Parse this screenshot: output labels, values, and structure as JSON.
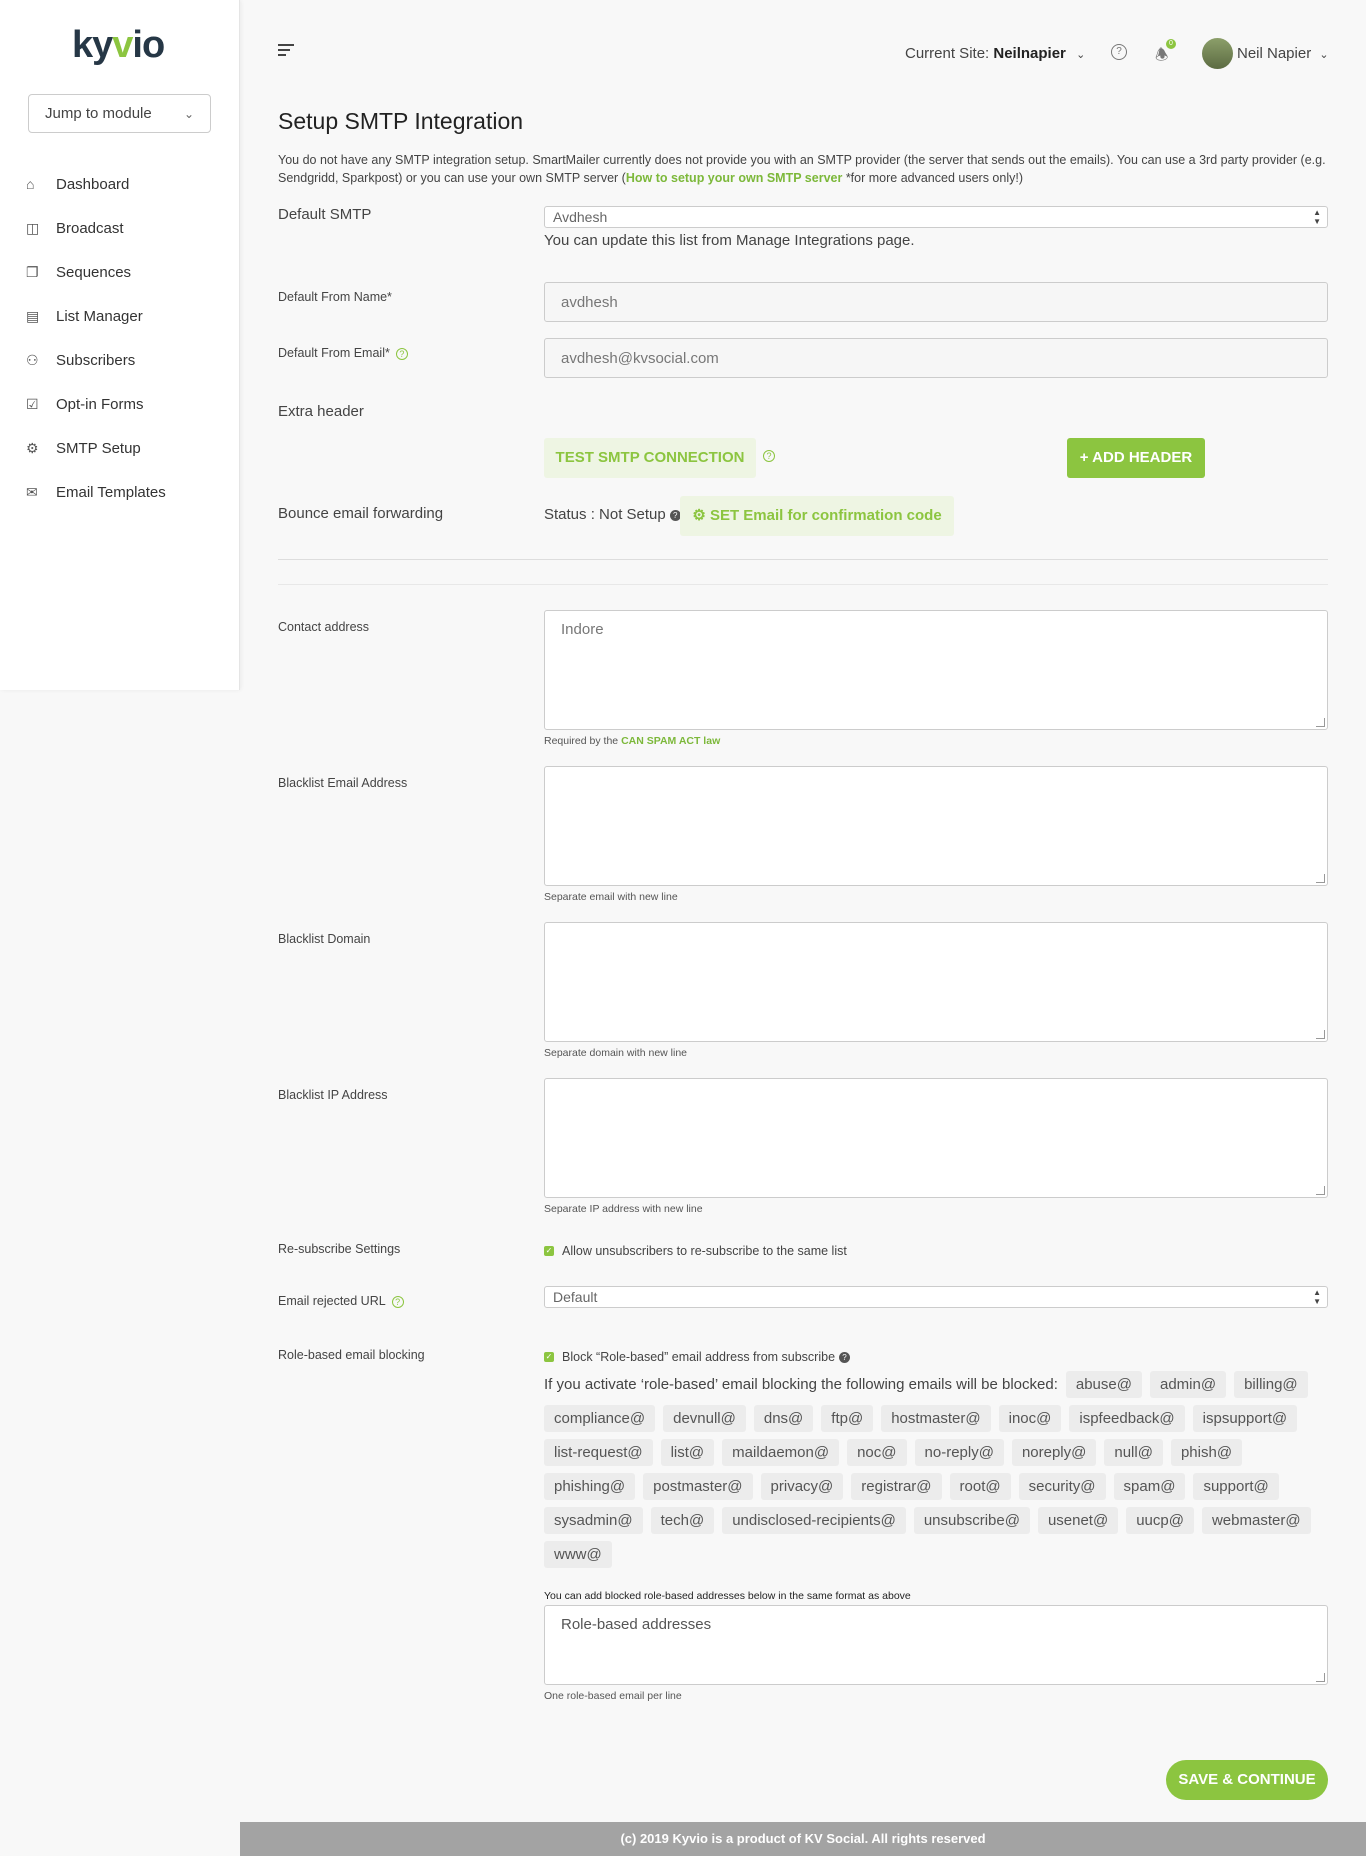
{
  "brand": {
    "logo_text_1": "ky",
    "logo_text_2": "v",
    "logo_text_3": "io"
  },
  "sidebar": {
    "jump_label": "Jump to module",
    "items": [
      {
        "label": "Dashboard",
        "icon": "home-icon"
      },
      {
        "label": "Broadcast",
        "icon": "broadcast-icon"
      },
      {
        "label": "Sequences",
        "icon": "sequences-icon"
      },
      {
        "label": "List Manager",
        "icon": "list-icon"
      },
      {
        "label": "Subscribers",
        "icon": "users-icon"
      },
      {
        "label": "Opt-in Forms",
        "icon": "checkbox-icon"
      },
      {
        "label": "SMTP Setup",
        "icon": "gear-icon"
      },
      {
        "label": "Email Templates",
        "icon": "envelope-icon"
      }
    ]
  },
  "header": {
    "site_prefix": "Current Site:",
    "site_name": "Neilnapier",
    "notif_count": "0",
    "user_name": "Neil Napier"
  },
  "main": {
    "title": "Setup SMTP Integration",
    "intro_1": "You do not have any SMTP integration setup. SmartMailer currently does not provide you with an SMTP provider (the server that sends out the emails). You can use a 3rd party provider (e.g. Sendgridd, Sparkpost) or you can use your own SMTP server (",
    "intro_link": "How to setup your own SMTP server",
    "intro_2": " *for more advanced users only!)",
    "default_smtp_label": "Default SMTP",
    "default_smtp_value": "Avdhesh",
    "default_smtp_note": "You can update this list from Manage Integrations page.",
    "from_name_label": "Default From Name*",
    "from_name_value": "avdhesh",
    "from_email_label": "Default From Email*",
    "from_email_value": "avdhesh@kvsocial.com",
    "extra_header_label": "Extra header",
    "test_btn": "TEST SMTP CONNECTION",
    "add_header_btn": "+ ADD HEADER",
    "bounce_label": "Bounce email forwarding",
    "bounce_status": "Status : Not Setup",
    "bounce_btn": "SET Email for confirmation code",
    "contact_label": "Contact address",
    "contact_value": "Indore",
    "contact_help_1": "Required by the ",
    "contact_help_link": "CAN SPAM ACT law",
    "bl_email_label": "Blacklist Email Address",
    "bl_email_help": "Separate email with new line",
    "bl_domain_label": "Blacklist Domain",
    "bl_domain_help": "Separate domain with new line",
    "bl_ip_label": "Blacklist IP Address",
    "bl_ip_help": "Separate IP address with new line",
    "resub_label": "Re-subscribe Settings",
    "resub_check": "Allow unsubscribers to re-subscribe to the same list",
    "rejected_label": "Email rejected URL",
    "rejected_value": "Default",
    "role_label": "Role-based email blocking",
    "role_check": "Block “Role-based” email address from subscribe",
    "role_intro": "If you activate ‘role-based’ email blocking the following emails will be blocked:",
    "role_tags": [
      "abuse@",
      "admin@",
      "billing@",
      "compliance@",
      "devnull@",
      "dns@",
      "ftp@",
      "hostmaster@",
      "inoc@",
      "ispfeedback@",
      "ispsupport@",
      "list-request@",
      "list@",
      "maildaemon@",
      "noc@",
      "no-reply@",
      "noreply@",
      "null@",
      "phish@",
      "phishing@",
      "postmaster@",
      "privacy@",
      "registrar@",
      "root@",
      "security@",
      "spam@",
      "support@",
      "sysadmin@",
      "tech@",
      "undisclosed-recipients@",
      "unsubscribe@",
      "usenet@",
      "uucp@",
      "webmaster@",
      "www@"
    ],
    "role_add_note": "You can add blocked role-based addresses below in the same format as above",
    "role_placeholder": "Role-based addresses",
    "role_help": "One role-based email per line",
    "save_btn": "SAVE & CONTINUE"
  },
  "footer": "(c) 2019 Kyvio is a product of KV Social. All rights reserved",
  "colors": {
    "accent": "#8cc540",
    "sidebar_text": "#333333",
    "footer_bg": "#a3a3a3"
  }
}
